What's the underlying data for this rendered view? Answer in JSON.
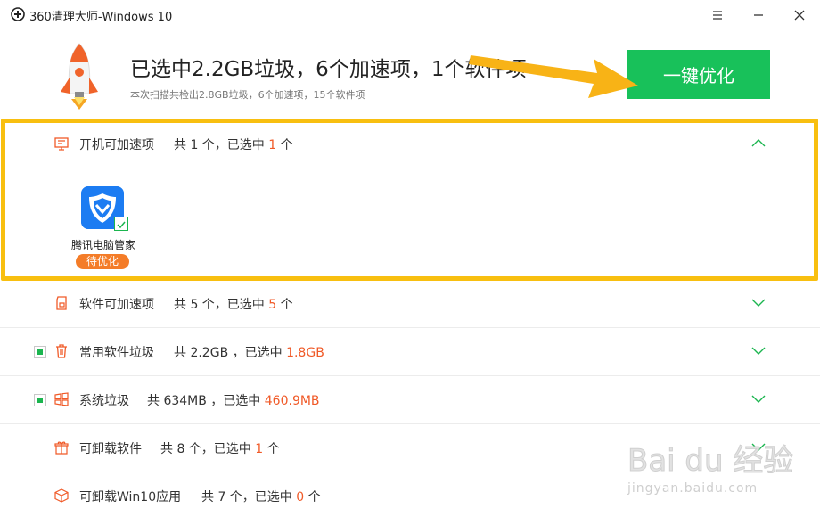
{
  "window": {
    "title": "360清理大师-Windows 10",
    "logo_icon": "plus-circle-icon",
    "controls": [
      "menu-icon",
      "minimize-icon",
      "close-icon"
    ]
  },
  "header": {
    "headline": "已选中2.2GB垃圾，6个加速项，1个软件项",
    "subline": "本次扫描共检出2.8GB垃圾，6个加速项，15个软件项",
    "button_label": "一键优化",
    "colors": {
      "primary": "#18c15a",
      "highlight": "#f8bf10",
      "accent": "#f05a28"
    }
  },
  "sections": [
    {
      "id": "startup",
      "label": "开机可加速项",
      "stat_prefix": "共 1 个，已选中",
      "stat_value": "1",
      "stat_suffix": "个",
      "expanded": true,
      "icon": "monitor-icon"
    },
    {
      "id": "software-speed",
      "label": "软件可加速项",
      "stat_prefix": "共 5 个，已选中",
      "stat_value": "5",
      "stat_suffix": "个",
      "expanded": false,
      "icon": "sd-card-icon"
    },
    {
      "id": "software-junk",
      "label": "常用软件垃圾",
      "stat_prefix": "共 2.2GB ，已选中",
      "stat_value": "1.8GB",
      "stat_suffix": "",
      "expanded": false,
      "icon": "trash-icon"
    },
    {
      "id": "system-junk",
      "label": "系统垃圾",
      "stat_prefix": "共 634MB ，已选中",
      "stat_value": "460.9MB",
      "stat_suffix": "",
      "expanded": false,
      "icon": "windows-icon"
    },
    {
      "id": "uninstall-software",
      "label": "可卸载软件",
      "stat_prefix": "共 8 个，已选中",
      "stat_value": "1",
      "stat_suffix": "个",
      "expanded": false,
      "icon": "gift-box-icon"
    },
    {
      "id": "uninstall-win10",
      "label": "可卸载Win10应用",
      "stat_prefix": "共 7 个，已选中",
      "stat_value": "0",
      "stat_suffix": "个",
      "expanded": false,
      "icon": "package-icon"
    }
  ],
  "startup_app": {
    "name": "腾讯电脑管家",
    "badge": "待优化",
    "icon": "tencent-shield-icon",
    "checked": true
  },
  "watermark": {
    "logo": "Bai du 经验",
    "url": "jingyan.baidu.com"
  }
}
